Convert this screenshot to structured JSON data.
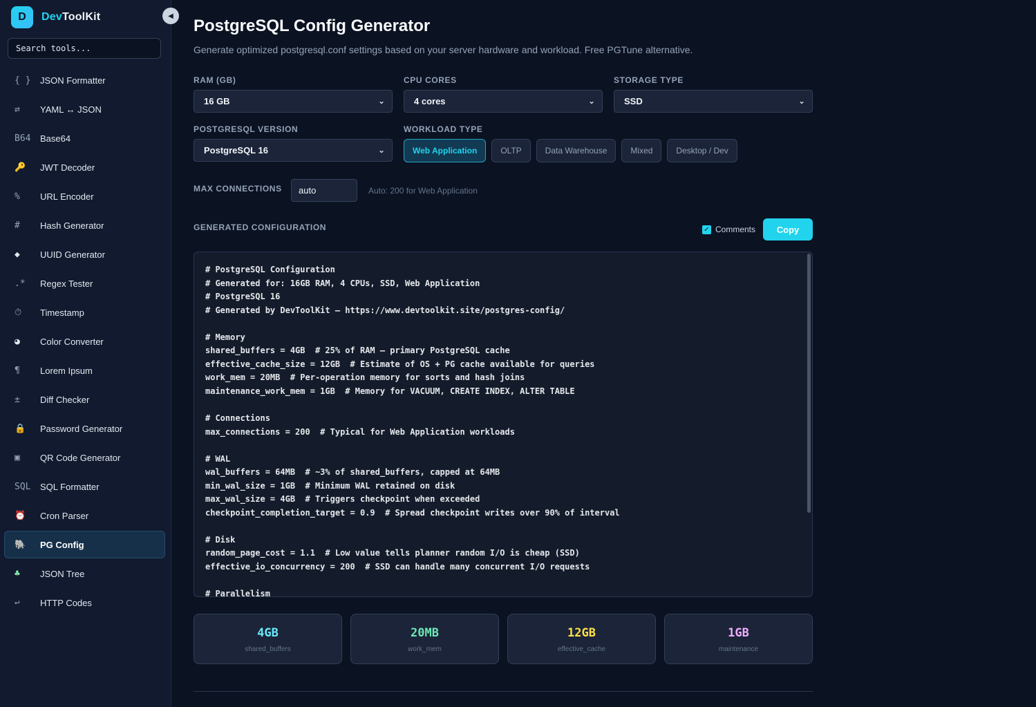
{
  "brand": {
    "logo": "D",
    "name_prefix": "Dev",
    "name_suffix": "ToolKit",
    "collapse_icon": "◀"
  },
  "search": {
    "placeholder": "Search tools..."
  },
  "sidebar": {
    "items": [
      {
        "icon": "{ }",
        "label": "JSON Formatter"
      },
      {
        "icon": "⇄",
        "label": "YAML ↔ JSON"
      },
      {
        "icon": "B64",
        "label": "Base64"
      },
      {
        "icon": "🔑",
        "label": "JWT Decoder"
      },
      {
        "icon": "%",
        "label": "URL Encoder"
      },
      {
        "icon": "#",
        "label": "Hash Generator"
      },
      {
        "icon": "◆",
        "label": "UUID Generator"
      },
      {
        "icon": ".*",
        "label": "Regex Tester"
      },
      {
        "icon": "⏱",
        "label": "Timestamp"
      },
      {
        "icon": "◕",
        "label": "Color Converter"
      },
      {
        "icon": "¶",
        "label": "Lorem Ipsum"
      },
      {
        "icon": "±",
        "label": "Diff Checker"
      },
      {
        "icon": "🔒",
        "label": "Password Generator"
      },
      {
        "icon": "▣",
        "label": "QR Code Generator"
      },
      {
        "icon": "SQL",
        "label": "SQL Formatter"
      },
      {
        "icon": "⏰",
        "label": "Cron Parser"
      },
      {
        "icon": "🐘",
        "label": "PG Config"
      },
      {
        "icon": "♣",
        "label": "JSON Tree"
      },
      {
        "icon": "↩",
        "label": "HTTP Codes"
      }
    ],
    "active_label": "PG Config"
  },
  "main": {
    "title": "PostgreSQL Config Generator",
    "subtitle": "Generate optimized postgresql.conf settings based on your server hardware and workload. Free PGTune alternative.",
    "fields": {
      "ram": {
        "label": "RAM (GB)",
        "value": "16 GB"
      },
      "cpu": {
        "label": "CPU CORES",
        "value": "4 cores"
      },
      "storage": {
        "label": "STORAGE TYPE",
        "value": "SSD"
      },
      "pg_version": {
        "label": "POSTGRESQL VERSION",
        "value": "PostgreSQL 16"
      },
      "workload": {
        "label": "WORKLOAD TYPE",
        "options": [
          "Web Application",
          "OLTP",
          "Data Warehouse",
          "Mixed",
          "Desktop / Dev"
        ],
        "selected": "Web Application"
      },
      "max_connections": {
        "label": "MAX CONNECTIONS",
        "value": "auto",
        "hint": "Auto: 200 for Web Application"
      }
    },
    "generated": {
      "label": "GENERATED CONFIGURATION",
      "comments_label": "Comments",
      "comments_checked": true,
      "copy_label": "Copy",
      "config_text": "# PostgreSQL Configuration\n# Generated for: 16GB RAM, 4 CPUs, SSD, Web Application\n# PostgreSQL 16\n# Generated by DevToolKit — https://www.devtoolkit.site/postgres-config/\n\n# Memory\nshared_buffers = 4GB  # 25% of RAM — primary PostgreSQL cache\neffective_cache_size = 12GB  # Estimate of OS + PG cache available for queries\nwork_mem = 20MB  # Per-operation memory for sorts and hash joins\nmaintenance_work_mem = 1GB  # Memory for VACUUM, CREATE INDEX, ALTER TABLE\n\n# Connections\nmax_connections = 200  # Typical for Web Application workloads\n\n# WAL\nwal_buffers = 64MB  # ~3% of shared_buffers, capped at 64MB\nmin_wal_size = 1GB  # Minimum WAL retained on disk\nmax_wal_size = 4GB  # Triggers checkpoint when exceeded\ncheckpoint_completion_target = 0.9  # Spread checkpoint writes over 90% of interval\n\n# Disk\nrandom_page_cost = 1.1  # Low value tells planner random I/O is cheap (SSD)\neffective_io_concurrency = 200  # SSD can handle many concurrent I/O requests\n\n# Parallelism"
    },
    "stats": [
      {
        "value": "4GB",
        "label": "shared_buffers",
        "color": "#67e8f9"
      },
      {
        "value": "20MB",
        "label": "work_mem",
        "color": "#6ee7b7"
      },
      {
        "value": "12GB",
        "label": "effective_cache",
        "color": "#fde047"
      },
      {
        "value": "1GB",
        "label": "maintenance",
        "color": "#f0abfc"
      }
    ]
  },
  "colors": {
    "accent": "#22d3ee",
    "background": "#0b1222",
    "sidebar": "#111a2e"
  }
}
